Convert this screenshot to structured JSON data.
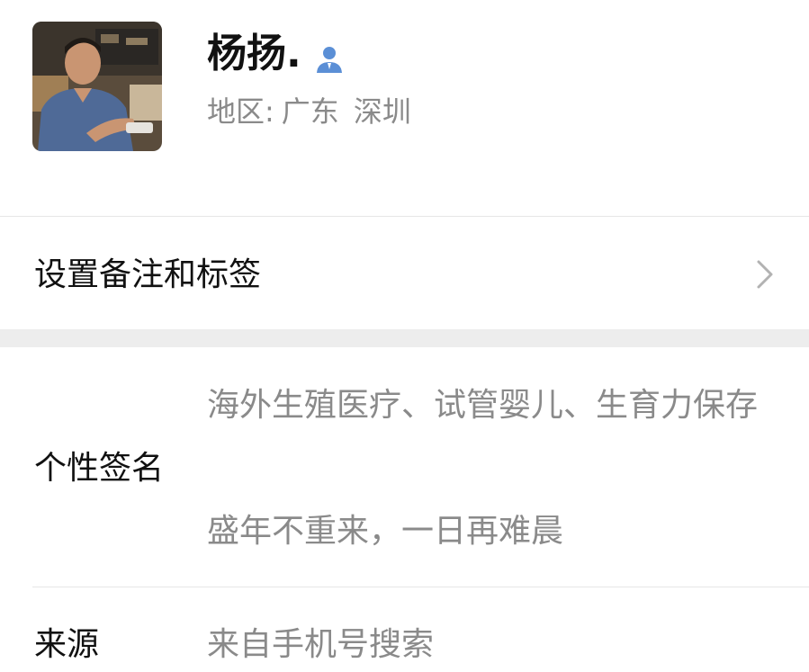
{
  "profile": {
    "name": "杨扬.",
    "region_label": "地区:",
    "region_province": "广东",
    "region_city": "深圳",
    "contact_icon": "person-icon",
    "avatar_icon": "avatar-photo"
  },
  "remark": {
    "label": "设置备注和标签",
    "icon": "chevron-right-icon"
  },
  "signature": {
    "label": "个性签名",
    "line1": "海外生殖医疗、试管婴儿、生育力保存",
    "line2": "盛年不重来，一日再难晨"
  },
  "source": {
    "label": "来源",
    "value": "来自手机号搜索"
  },
  "colors": {
    "accent_icon": "#5b8fd6",
    "secondary_text": "#8a8a8a",
    "separator": "#ededed"
  }
}
